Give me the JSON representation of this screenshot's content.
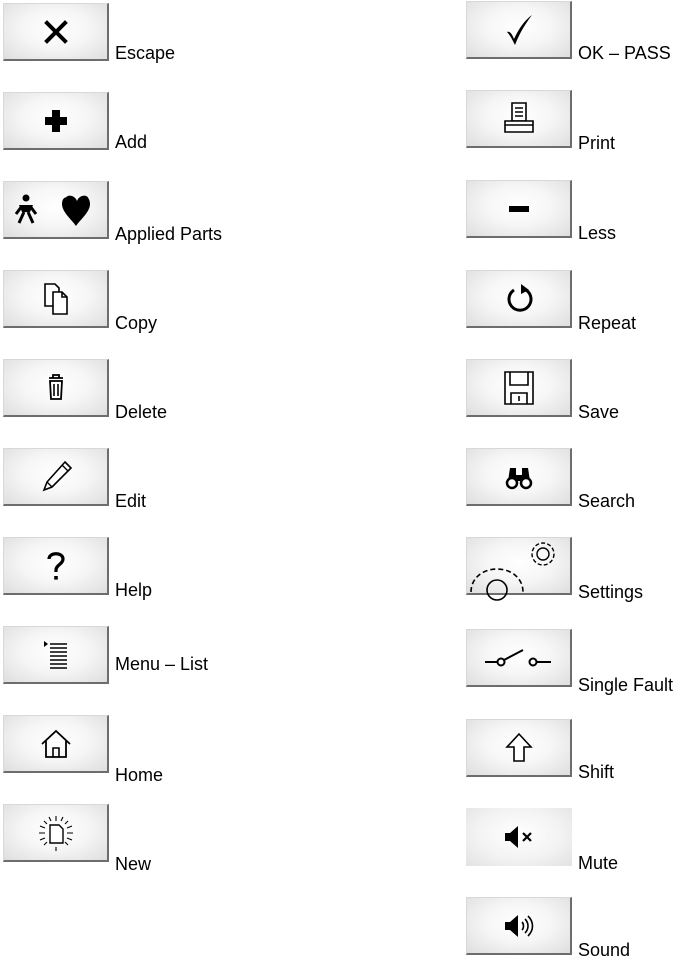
{
  "left_column": [
    {
      "label": "Escape",
      "icon": "close-icon"
    },
    {
      "label": "Add",
      "icon": "plus-icon"
    },
    {
      "label": "Applied Parts",
      "icon": "person-heart-icon"
    },
    {
      "label": "Copy",
      "icon": "copy-icon"
    },
    {
      "label": "Delete",
      "icon": "trash-icon"
    },
    {
      "label": "Edit",
      "icon": "pencil-icon"
    },
    {
      "label": "Help",
      "icon": "question-icon"
    },
    {
      "label": "Menu – List",
      "icon": "menu-list-icon"
    },
    {
      "label": "Home",
      "icon": "home-icon"
    },
    {
      "label": "New",
      "icon": "new-document-icon"
    }
  ],
  "right_column": [
    {
      "label": "OK – PASS",
      "icon": "checkmark-icon"
    },
    {
      "label": "Print",
      "icon": "printer-icon"
    },
    {
      "label": "Less",
      "icon": "minus-icon"
    },
    {
      "label": "Repeat",
      "icon": "repeat-icon"
    },
    {
      "label": "Save",
      "icon": "floppy-disk-icon"
    },
    {
      "label": "Search",
      "icon": "binoculars-icon"
    },
    {
      "label": "Settings",
      "icon": "gears-icon"
    },
    {
      "label": "Single Fault",
      "icon": "switch-icon"
    },
    {
      "label": "Shift",
      "icon": "shift-arrow-icon"
    },
    {
      "label": "Mute",
      "icon": "speaker-mute-icon"
    },
    {
      "label": "Sound",
      "icon": "speaker-sound-icon"
    }
  ]
}
